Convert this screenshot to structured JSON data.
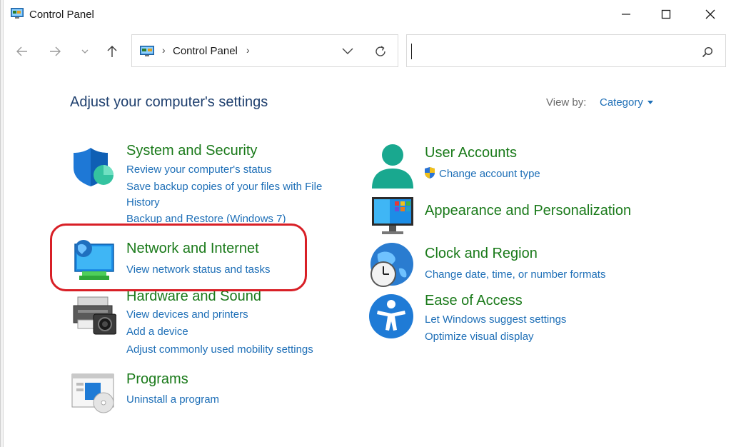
{
  "window": {
    "title": "Control Panel",
    "controls": {
      "minimize": "minimize",
      "maximize": "maximize",
      "close": "close"
    }
  },
  "address_bar": {
    "breadcrumb": "Control Panel",
    "search_placeholder": ""
  },
  "header": {
    "title": "Adjust your computer's settings",
    "view_by_label": "View by:",
    "view_by_value": "Category"
  },
  "categories": {
    "system_security": {
      "title": "System and Security",
      "links": [
        "Review your computer's status",
        "Save backup copies of your files with File",
        "History",
        "Backup and Restore (Windows 7)"
      ]
    },
    "network_internet": {
      "title": "Network and Internet",
      "links": [
        "View network status and tasks"
      ]
    },
    "hardware_sound": {
      "title": "Hardware and Sound",
      "links": [
        "View devices and printers",
        "Add a device",
        "Adjust commonly used mobility settings"
      ]
    },
    "programs": {
      "title": "Programs",
      "links": [
        "Uninstall a program"
      ]
    },
    "user_accounts": {
      "title": "User Accounts",
      "links": [
        "Change account type"
      ]
    },
    "appearance": {
      "title": "Appearance and Personalization",
      "links": []
    },
    "clock_region": {
      "title": "Clock and Region",
      "links": [
        "Change date, time, or number formats"
      ]
    },
    "ease_access": {
      "title": "Ease of Access",
      "links": [
        "Let Windows suggest settings",
        "Optimize visual display"
      ]
    }
  },
  "colors": {
    "category_title": "#1a7a1a",
    "link": "#1e6fb7",
    "heading": "#1e3f6e",
    "highlight": "#d81f26"
  }
}
